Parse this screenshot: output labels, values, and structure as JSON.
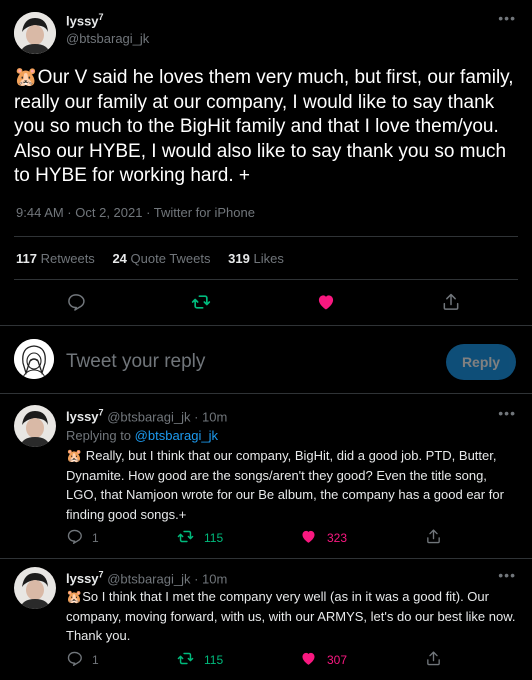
{
  "main_tweet": {
    "author_name": "lyssy",
    "author_sup": "7",
    "author_handle": "@btsbaragi_jk",
    "emoji": "🐹",
    "text": "Our V said he loves them very much, but first, our family, really our family at our company, I would like to say thank you so much to the BigHit family and that I love them/you. Also our HYBE, I would also like to say thank you so much to HYBE for working hard. +",
    "timestamp": "9:44 AM · Oct 2, 2021 · Twitter for iPhone",
    "stats": {
      "retweets_count": "117",
      "retweets_label": "Retweets",
      "quotes_count": "24",
      "quotes_label": "Quote Tweets",
      "likes_count": "319",
      "likes_label": "Likes"
    }
  },
  "compose": {
    "placeholder": "Tweet your reply",
    "reply_button": "Reply"
  },
  "replies": [
    {
      "author_name": "lyssy",
      "author_sup": "7",
      "handle_time": "@btsbaragi_jk · 10m",
      "replying_prefix": "Replying to",
      "replying_handle": "@btsbaragi_jk",
      "emoji": "🐹",
      "text": " Really, but I think that our company, BigHit, did a good job. PTD, Butter, Dynamite. How good are the songs/aren't they good? Even the title song, LGO, that Namjoon wrote for our Be album, the company has a good ear for finding good songs.+",
      "replies_count": "1",
      "retweets_count": "115",
      "likes_count": "323"
    },
    {
      "author_name": "lyssy",
      "author_sup": "7",
      "handle_time": "@btsbaragi_jk · 10m",
      "emoji": "🐹",
      "text": "So I think that I met the company very well (as in it was a good fit). Our company, moving forward, with us, with our ARMYS, let's do our best like now. Thank you.",
      "replies_count": "1",
      "retweets_count": "115",
      "likes_count": "307"
    }
  ],
  "colors": {
    "background": "#000000",
    "text": "#e7e9ea",
    "muted": "#71767b",
    "accent": "#1d9bf0",
    "like": "#f91880",
    "retweet": "#00ba7c"
  }
}
